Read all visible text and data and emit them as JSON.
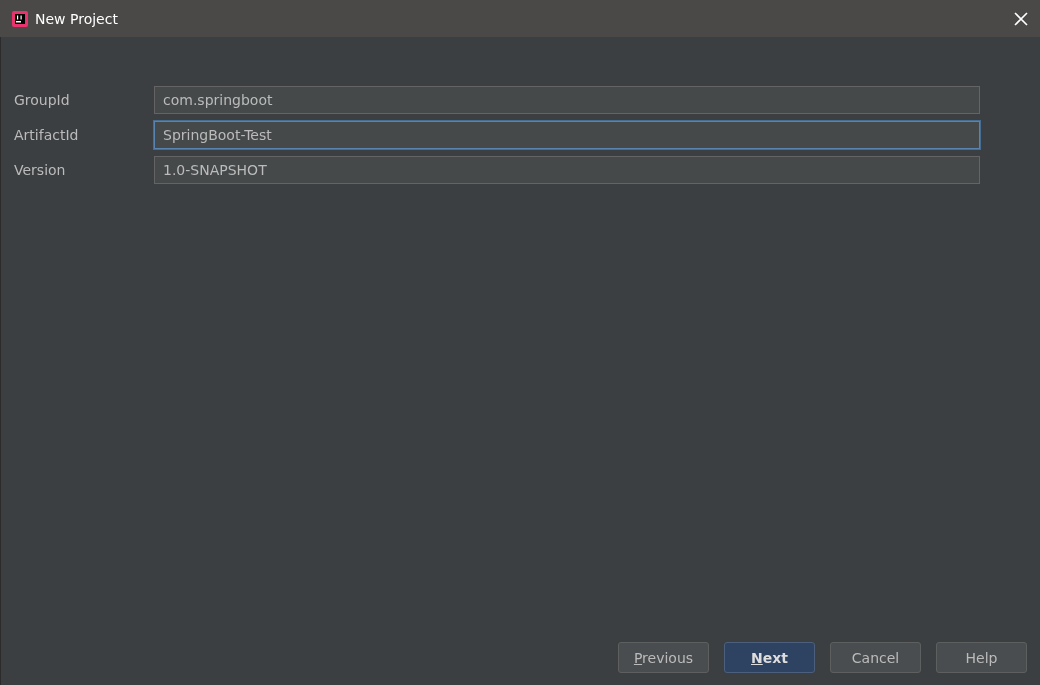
{
  "window": {
    "title": "New Project"
  },
  "fields": [
    {
      "label": "GroupId",
      "value": "com.springboot",
      "focused": false
    },
    {
      "label": "ArtifactId",
      "value": "SpringBoot-Test",
      "focused": true
    },
    {
      "label": "Version",
      "value": "1.0-SNAPSHOT",
      "focused": false
    }
  ],
  "buttons": [
    {
      "label": "Previous",
      "kind": "normal",
      "mnemonic": true
    },
    {
      "label": "Next",
      "kind": "default",
      "mnemonic": true
    },
    {
      "label": "Cancel",
      "kind": "normal",
      "mnemonic": false
    },
    {
      "label": "Help",
      "kind": "normal",
      "mnemonic": false
    }
  ]
}
